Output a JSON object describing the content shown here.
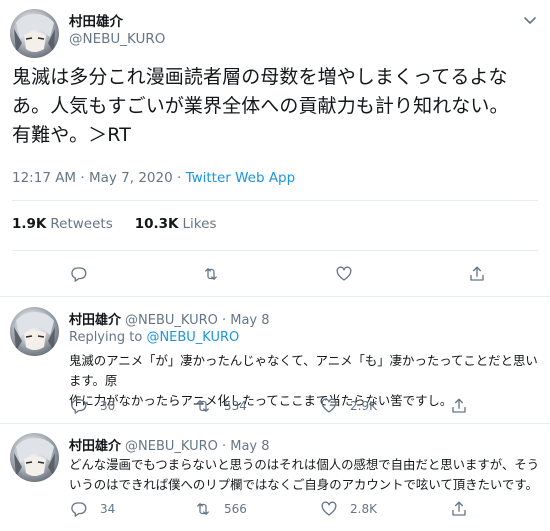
{
  "tweet": {
    "author_name": "村田雄介",
    "author_handle": "@NEBU_KURO",
    "text_line1": "鬼滅は多分これ漫画読者層の母数を増やしまくってるよな",
    "text_line2": "あ。人気もすごいが業界全体への貢献力も計り知れない。",
    "text_line3": "有難や。＞RT",
    "timestamp": "12:17 AM · May 7, 2020 · ",
    "source": "Twitter Web App",
    "retweets_count": "1.9K",
    "retweets_label": "Retweets",
    "likes_count": "10.3K",
    "likes_label": "Likes"
  },
  "replies": [
    {
      "author_name": "村田雄介",
      "meta": "@NEBU_KURO · May 8",
      "replying_prefix": "Replying to ",
      "replying_to": "@NEBU_KURO",
      "text_line1": "鬼滅のアニメ「が」凄かったんじゃなくて、アニメ「も」凄かったってことだと思います。原",
      "text_line2": "作に力がなかったらアニメ化したってここまで当たらない筈ですし。",
      "replies": "30",
      "retweets": "534",
      "likes": "2.9K"
    },
    {
      "author_name": "村田雄介",
      "meta": "@NEBU_KURO · May 8",
      "text_line1": "どんな漫画でもつまらないと思うのはそれは個人の感想で自由だと思いますが、そう",
      "text_line2": "いうのはできれば僕へのリプ欄ではなくご自身のアカウントで呟いて頂きたいです。",
      "replies": "34",
      "retweets": "566",
      "likes": "2.8K"
    }
  ],
  "icons": {
    "reply": "reply-icon",
    "retweet": "retweet-icon",
    "like": "heart-icon",
    "share": "share-icon",
    "more": "chevron-down-icon"
  },
  "colors": {
    "link": "#1b95e0",
    "secondary_text": "#657786",
    "divider": "#e6ecf0"
  }
}
